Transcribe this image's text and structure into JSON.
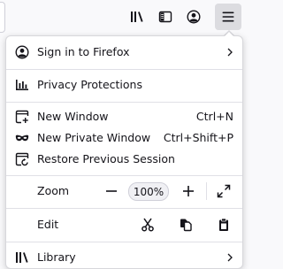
{
  "toolbar": {
    "buttons": [
      {
        "name": "library",
        "icon": "library-icon"
      },
      {
        "name": "sidebars",
        "icon": "sidebar-icon"
      },
      {
        "name": "account",
        "icon": "account-icon"
      },
      {
        "name": "app-menu",
        "icon": "hamburger-menu-icon",
        "active": true
      }
    ]
  },
  "menu": {
    "sign_in": {
      "label": "Sign in to Firefox",
      "icon": "account-icon",
      "has_submenu": true
    },
    "privacy": {
      "label": "Privacy Protections",
      "icon": "privacy-dashboard-icon"
    },
    "new_window": {
      "label": "New Window",
      "shortcut": "Ctrl+N",
      "icon": "new-window-icon"
    },
    "private_window": {
      "label": "New Private Window",
      "shortcut": "Ctrl+Shift+P",
      "icon": "private-mask-icon"
    },
    "restore_session": {
      "label": "Restore Previous Session",
      "icon": "restore-session-icon"
    },
    "zoom": {
      "label": "Zoom",
      "value": "100%",
      "minus": "−",
      "plus": "+"
    },
    "edit": {
      "label": "Edit"
    },
    "library": {
      "label": "Library",
      "icon": "library-icon",
      "has_submenu": true
    }
  },
  "colors": {
    "toolbar_bg": "#f9f9fb",
    "panel_bg": "#ffffff",
    "active_button_bg": "#dcdce0",
    "text": "#15141a",
    "separator": "#e0e0e6"
  }
}
